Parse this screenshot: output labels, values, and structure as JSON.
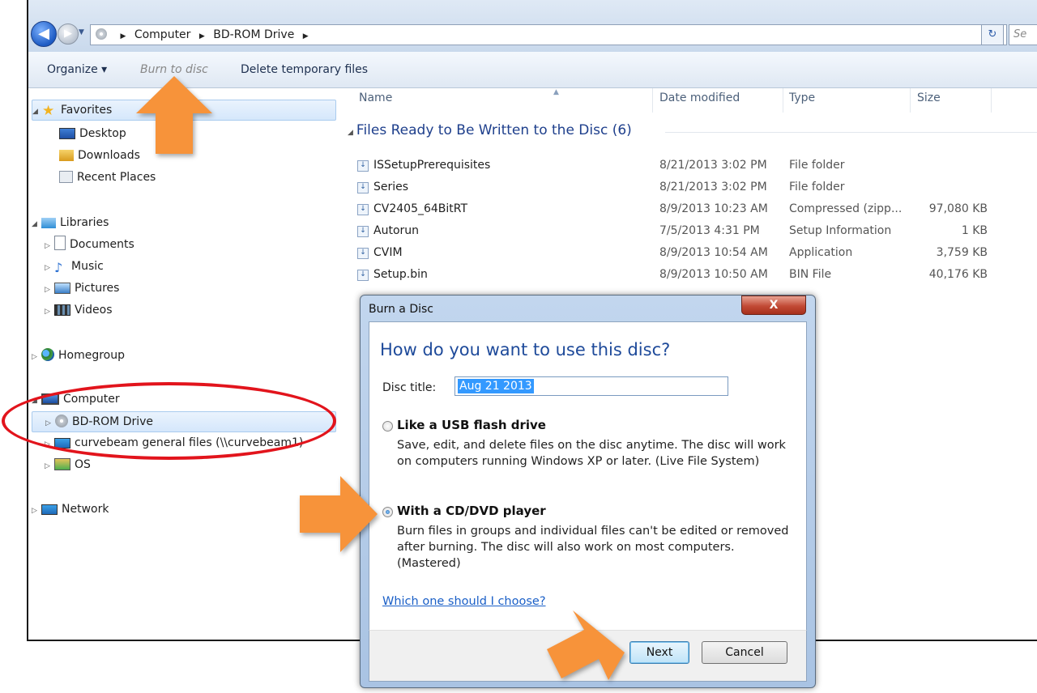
{
  "address_bar": {
    "crumbs": [
      "Computer",
      "BD-ROM Drive"
    ],
    "search_placeholder": "Se"
  },
  "toolbar": {
    "organize_label": "Organize ▾",
    "burn_label": "Burn to disc",
    "delete_label": "Delete temporary files"
  },
  "nav": {
    "favorites": "Favorites",
    "desktop": "Desktop",
    "downloads": "Downloads",
    "recent": "Recent Places",
    "libraries": "Libraries",
    "documents": "Documents",
    "music": "Music",
    "pictures": "Pictures",
    "videos": "Videos",
    "homegroup": "Homegroup",
    "computer": "Computer",
    "bd_rom": "BD-ROM Drive",
    "network_share": "curvebeam general files (\\\\curvebeam1)",
    "os": "OS",
    "network": "Network"
  },
  "columns": {
    "name": "Name",
    "date": "Date modified",
    "type": "Type",
    "size": "Size"
  },
  "group_label": "Files Ready to Be Written to the Disc (6)",
  "files": [
    {
      "name": "ISSetupPrerequisites",
      "date": "8/21/2013 3:02 PM",
      "type": "File folder",
      "size": ""
    },
    {
      "name": "Series",
      "date": "8/21/2013 3:02 PM",
      "type": "File folder",
      "size": ""
    },
    {
      "name": "CV2405_64BitRT",
      "date": "8/9/2013 10:23 AM",
      "type": "Compressed (zipp...",
      "size": "97,080 KB"
    },
    {
      "name": "Autorun",
      "date": "7/5/2013 4:31 PM",
      "type": "Setup Information",
      "size": "1 KB"
    },
    {
      "name": "CVIM",
      "date": "8/9/2013 10:54 AM",
      "type": "Application",
      "size": "3,759 KB"
    },
    {
      "name": "Setup.bin",
      "date": "8/9/2013 10:50 AM",
      "type": "BIN File",
      "size": "40,176 KB"
    }
  ],
  "dialog": {
    "title": "Burn a Disc",
    "close": "X",
    "heading": "How do you want to use this disc?",
    "disc_title_label": "Disc title:",
    "disc_title_value": "Aug 21 2013",
    "option1_title": "Like a USB flash drive",
    "option1_desc": "Save, edit, and delete files on the disc anytime. The disc will work on computers running Windows XP or later. (Live File System)",
    "option2_title": "With a CD/DVD player",
    "option2_desc": "Burn files in groups and individual files can't be edited or removed after burning. The disc will also work on most computers. (Mastered)",
    "selected_option": "With a CD/DVD player",
    "help_link": "Which one should I choose?",
    "next_label": "Next",
    "cancel_label": "Cancel"
  },
  "annotation_colors": {
    "arrow": "#f7933a",
    "ellipse": "#e2141c"
  }
}
